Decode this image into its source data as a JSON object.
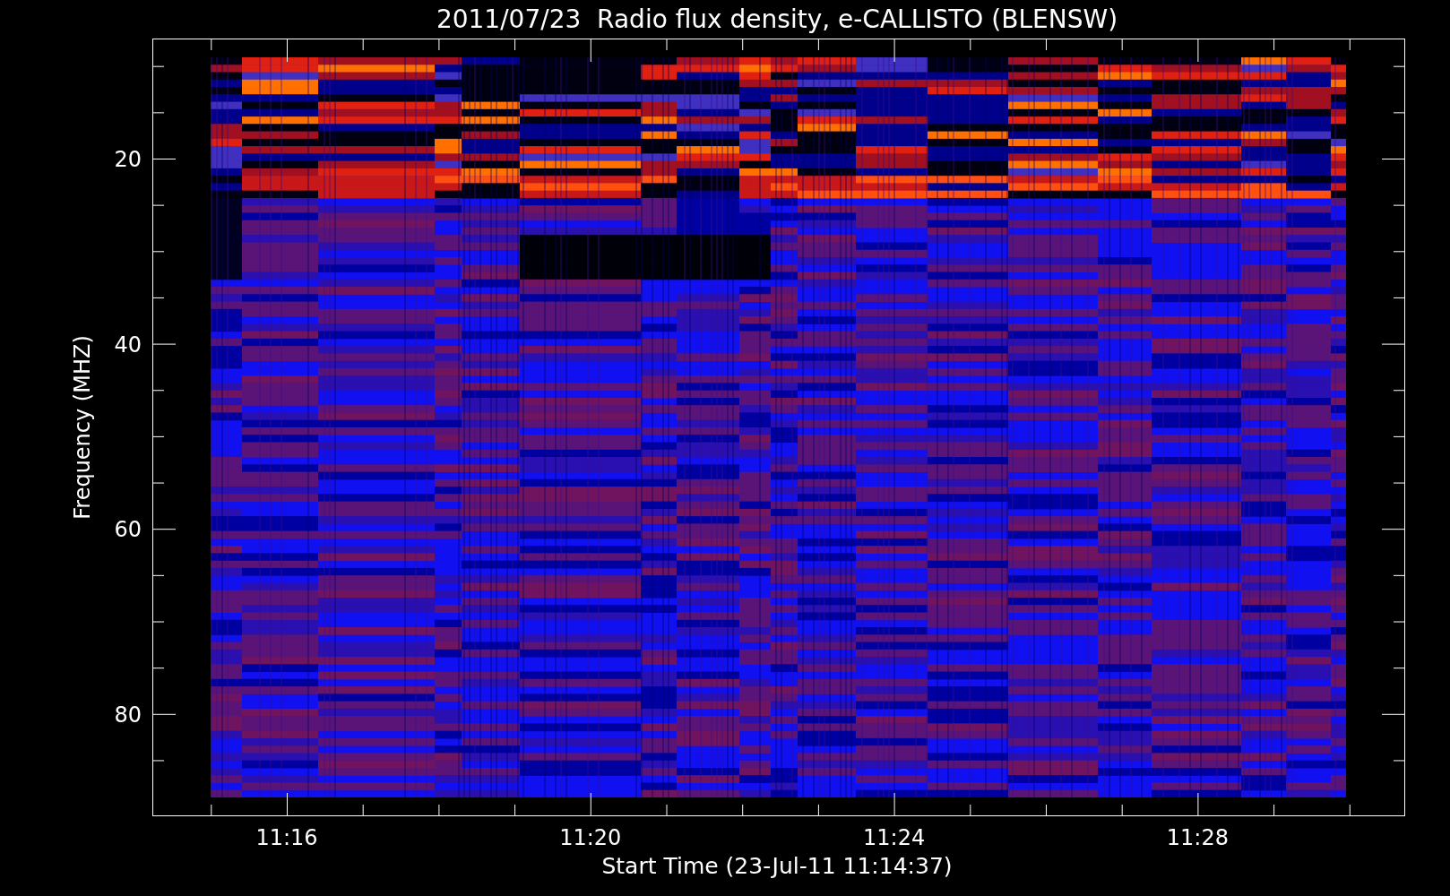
{
  "title": "2011/07/23  Radio flux density, e-CALLISTO (BLENSW)",
  "y_axis": {
    "label": "Frequency (MHZ)",
    "ticks": [
      "20",
      "40",
      "60",
      "80"
    ]
  },
  "x_axis": {
    "label": "Start Time (23-Jul-11 11:14:37)",
    "ticks": [
      "11:16",
      "11:20",
      "11:24",
      "11:28"
    ]
  }
}
